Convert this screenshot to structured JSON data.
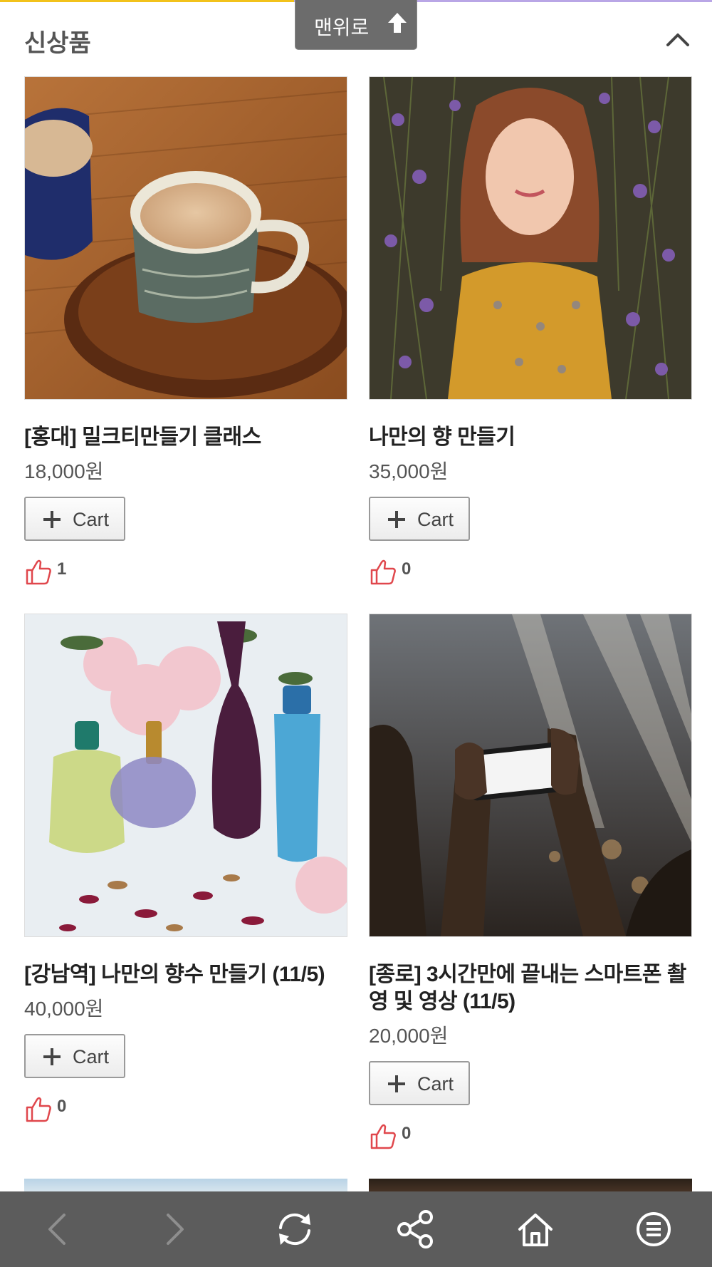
{
  "top_button": {
    "label": "맨위로",
    "icon": "arrow-up-icon"
  },
  "section": {
    "title": "신상품",
    "toggle_icon": "chevron-up-icon"
  },
  "products": [
    {
      "name": "[홍대] 밀크티만들기 클래스",
      "price": "18,000원",
      "cart_label": "Cart",
      "likes": "1",
      "image": "milk-tea-cup-photo"
    },
    {
      "name": "나만의 향 만들기",
      "price": "35,000원",
      "cart_label": "Cart",
      "likes": "0",
      "image": "girl-in-lavender-photo"
    },
    {
      "name": "[강남역] 나만의 향수 만들기 (11/5)",
      "price": "40,000원",
      "cart_label": "Cart",
      "likes": "0",
      "image": "perfume-bottles-photo"
    },
    {
      "name": "[종로] 3시간만에 끝내는 스마트폰 촬영 및 영상 (11/5)",
      "price": "20,000원",
      "cart_label": "Cart",
      "likes": "0",
      "image": "smartphone-filming-photo"
    }
  ],
  "bottom_nav": [
    "back-icon",
    "forward-icon",
    "refresh-icon",
    "share-icon",
    "home-icon",
    "menu-icon"
  ],
  "colors": {
    "accent_yellow": "#f2c21b",
    "accent_purple": "#b9a6e6",
    "nav_bg": "#5c5c5c",
    "like_red": "#e0474c"
  }
}
